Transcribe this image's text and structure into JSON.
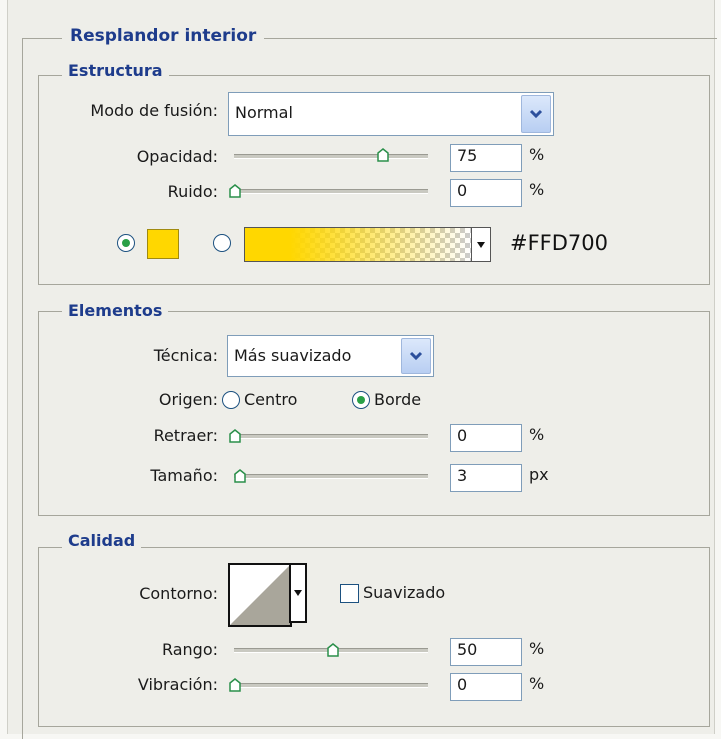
{
  "window_title": "Resplandor interior",
  "structure": {
    "title": "Estructura",
    "blend_mode_label": "Modo de fusión:",
    "blend_mode_value": "Normal",
    "opacity_label": "Opacidad:",
    "opacity_value": "75",
    "opacity_unit": "%",
    "opacity_level": 0.75,
    "noise_label": "Ruido:",
    "noise_value": "0",
    "noise_unit": "%",
    "noise_level": 0.0,
    "color_hex": "#FFD700",
    "swatch_color": "#FFD700",
    "color_radio_selected": true,
    "gradient_radio_selected": false
  },
  "elements": {
    "title": "Elementos",
    "technique_label": "Técnica:",
    "technique_value": "Más suavizado",
    "source_label": "Origen:",
    "source_center_label": "Centro",
    "source_edge_label": "Borde",
    "source_selected": "Borde",
    "choke_label": "Retraer:",
    "choke_value": "0",
    "choke_unit": "%",
    "choke_level": 0.0,
    "size_label": "Tamaño:",
    "size_value": "3",
    "size_unit": "px",
    "size_level": 0.02
  },
  "quality": {
    "title": "Calidad",
    "contour_label": "Contorno:",
    "antialiased_label": "Suavizado",
    "antialiased_checked": false,
    "range_label": "Rango:",
    "range_value": "50",
    "range_unit": "%",
    "range_level": 0.5,
    "jitter_label": "Vibración:",
    "jitter_value": "0",
    "jitter_unit": "%",
    "jitter_level": 0.0
  },
  "icons": {
    "dropdown": "chevron-down-icon",
    "slider": "slider-thumb-icon",
    "picker": "triangle-down-icon"
  },
  "colors": {
    "accent_title": "#1e3c8c",
    "radio_dot": "#2aa047"
  }
}
